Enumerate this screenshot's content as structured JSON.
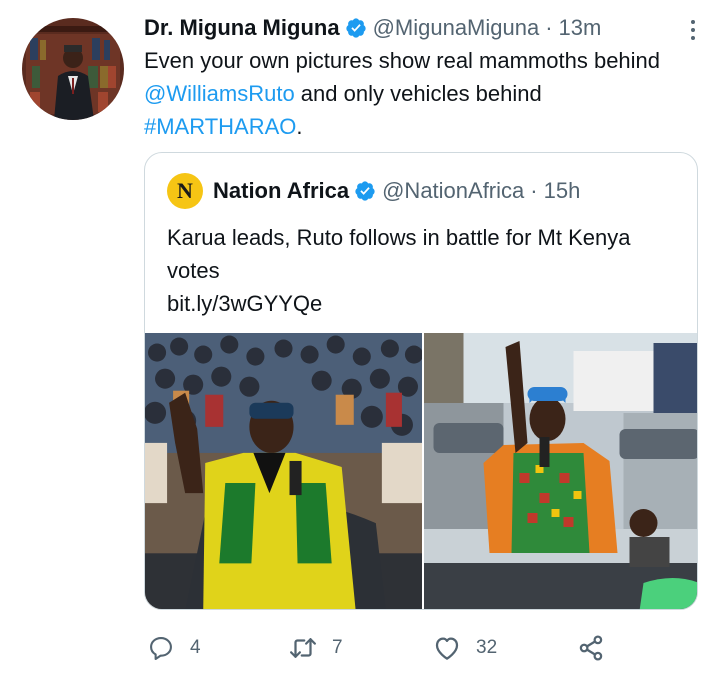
{
  "author": {
    "name": "Dr. Miguna Miguna",
    "handle": "@MigunaMiguna",
    "separator": "·",
    "time": "13m"
  },
  "tweet": {
    "line1": "Even your own pictures show real mammoths behind",
    "mention": "@WilliamsRuto",
    "line2_rest": " and only vehicles behind",
    "hashtag": "#MARTHARAO",
    "period": "."
  },
  "quoted": {
    "logo_letter": "N",
    "name": "Nation Africa",
    "handle": "@NationAfrica",
    "separator": "·",
    "time": "15h",
    "text": "Karua leads, Ruto follows in battle for Mt Kenya votes",
    "link": "bit.ly/3wGYYQe"
  },
  "actions": {
    "reply_count": "4",
    "retweet_count": "7",
    "like_count": "32"
  },
  "icons": {
    "verified": "verified-badge-icon",
    "more": "more-dots-icon",
    "reply": "reply-icon",
    "retweet": "retweet-icon",
    "like": "heart-icon",
    "share": "share-icon"
  },
  "colors": {
    "accent": "#1d9bf0",
    "secondary_text": "#536471",
    "border": "#cfd9de",
    "logo_yellow": "#f6c514"
  }
}
